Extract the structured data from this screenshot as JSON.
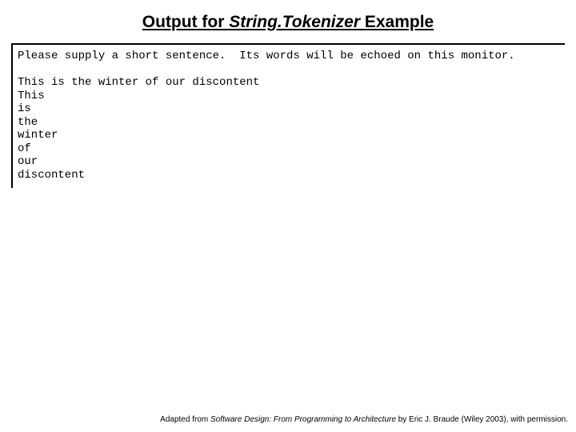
{
  "title": {
    "prefix": "Output for ",
    "italic": "String.Tokenizer",
    "suffix": " Example"
  },
  "console": {
    "prompt": "Please supply a short sentence.  Its words will be echoed on this monitor.",
    "blank": "",
    "input": "This is the winter of our discontent",
    "tokens": [
      "This",
      "is",
      "the",
      "winter",
      "of",
      "our",
      "discontent"
    ]
  },
  "credit": {
    "pre": "Adapted from ",
    "book": "Software Design: From Programming to Architecture",
    "post": " by Eric J. Braude (Wiley 2003), with permission."
  }
}
